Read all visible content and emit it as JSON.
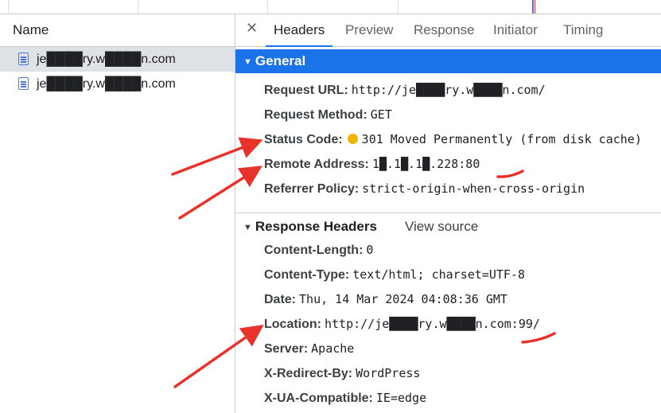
{
  "left_panel": {
    "header": "Name",
    "requests": [
      {
        "name": "je████ry.w████n.com",
        "selected": true
      },
      {
        "name": "je████ry.w████n.com",
        "selected": false
      }
    ]
  },
  "tabs": [
    "Headers",
    "Preview",
    "Response",
    "Initiator",
    "Timing"
  ],
  "active_tab": "Headers",
  "general": {
    "title": "General",
    "rows": [
      {
        "key": "Request URL:",
        "value": "http://je████ry.w████n.com/"
      },
      {
        "key": "Request Method:",
        "value": "GET"
      },
      {
        "key": "Status Code:",
        "value": "301 Moved Permanently (from disk cache)",
        "status_color": "#f0b400"
      },
      {
        "key": "Remote Address:",
        "value": "1█.1█.1█.228:80"
      },
      {
        "key": "Referrer Policy:",
        "value": "strict-origin-when-cross-origin"
      }
    ]
  },
  "response_headers": {
    "title": "Response Headers",
    "view_source": "View source",
    "rows": [
      {
        "key": "Content-Length:",
        "value": "0"
      },
      {
        "key": "Content-Type:",
        "value": "text/html; charset=UTF-8"
      },
      {
        "key": "Date:",
        "value": "Thu, 14 Mar 2024 04:08:36 GMT"
      },
      {
        "key": "Location:",
        "value": "http://je████ry.w████n.com:99/"
      },
      {
        "key": "Server:",
        "value": "Apache"
      },
      {
        "key": "X-Redirect-By:",
        "value": "WordPress"
      },
      {
        "key": "X-UA-Compatible:",
        "value": "IE=edge"
      }
    ]
  },
  "colors": {
    "accent": "#1a73e8",
    "annotation": "#e8322a"
  }
}
